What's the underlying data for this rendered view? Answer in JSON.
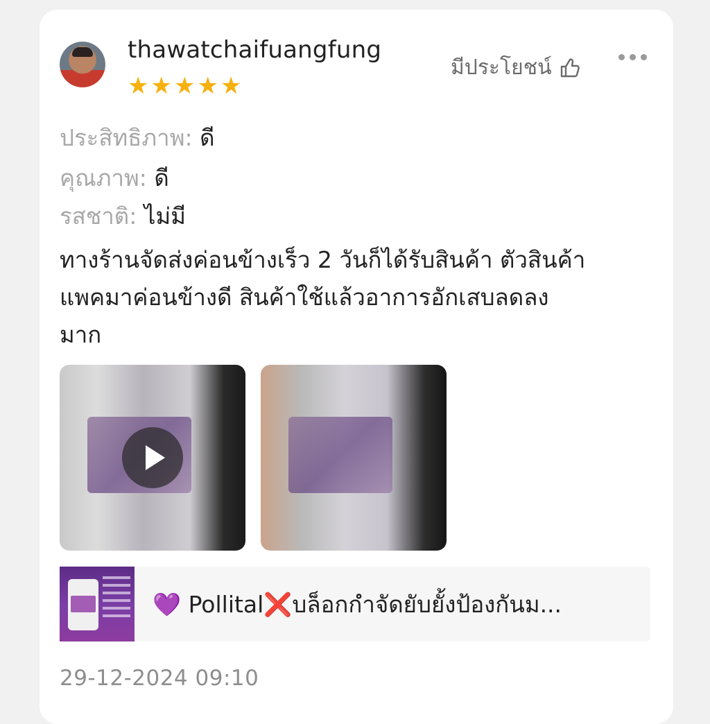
{
  "review": {
    "username": "thawatchaifuangfung",
    "rating": 5,
    "stars": [
      "★",
      "★",
      "★",
      "★",
      "★"
    ],
    "helpful_label": "มีประโยชน์",
    "attributes": [
      {
        "label": "ประสิทธิภาพ:",
        "value": "ดี"
      },
      {
        "label": "คุณภาพ:",
        "value": "ดี"
      },
      {
        "label": "รสชาติ:",
        "value": "ไม่มี"
      }
    ],
    "text_lines": [
      "ทางร้านจัดส่งค่อนข้างเร็ว 2 วันก็ได้รับสินค้า ตัวสินค้า",
      "แพคมาค่อนข้างดี สินค้าใช้แล้วอาการอักเสบลดลง",
      "มาก"
    ],
    "media": [
      {
        "type": "video",
        "icon": "play-icon"
      },
      {
        "type": "image"
      }
    ],
    "product": {
      "title": "💜 Pollital❌บล็อกกำจัดยับยั้งป้องกันม..."
    },
    "timestamp": "29-12-2024 09:10"
  },
  "colors": {
    "star": "#f6b10f",
    "text": "#222222",
    "muted": "#a8a8a8",
    "timestamp": "#8e8e8e"
  },
  "icons": [
    "thumbs-up-icon",
    "more-options-icon",
    "play-icon",
    "star-icon"
  ]
}
